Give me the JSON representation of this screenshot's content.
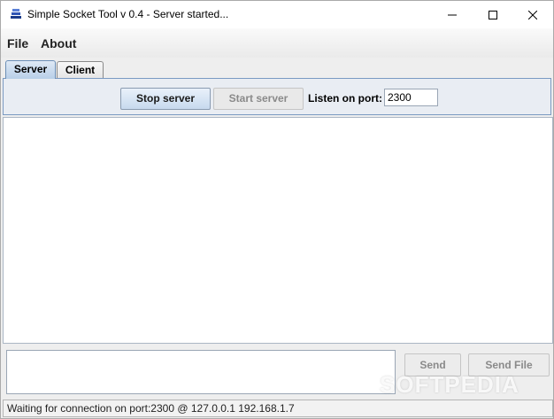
{
  "window": {
    "title": "Simple Socket Tool v 0.4 - Server started...",
    "icon": "stacked-layers-icon"
  },
  "menu": {
    "items": [
      "File",
      "About"
    ]
  },
  "tabs": [
    {
      "label": "Server",
      "active": true
    },
    {
      "label": "Client",
      "active": false
    }
  ],
  "server_panel": {
    "stop_button": "Stop server",
    "start_button": "Start server",
    "port_label": "Listen on port:",
    "port_value": "2300"
  },
  "send_panel": {
    "send_button": "Send",
    "send_file_button": "Send File"
  },
  "status": "Waiting for connection on port:2300 @ 127.0.0.1 192.168.1.7",
  "watermark": "SOFTPEDIA",
  "colors": {
    "tab_active": "#b8cfe8",
    "panel_border": "#7a9ac2",
    "disabled_text": "#8a8a8a"
  }
}
